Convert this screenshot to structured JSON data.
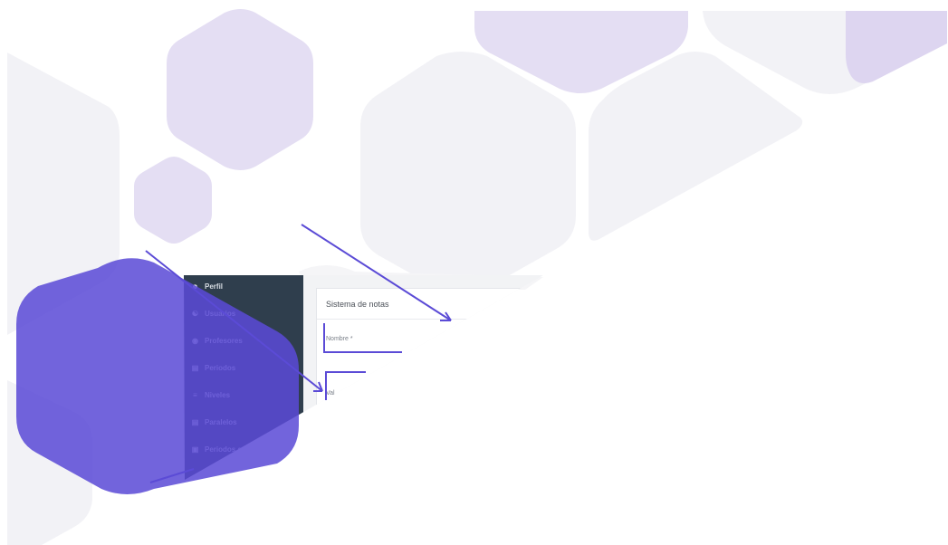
{
  "sidebar": {
    "items": [
      {
        "label": "Perfil",
        "icon": "user-icon"
      },
      {
        "label": "Usuarios",
        "icon": "users-icon"
      },
      {
        "label": "Profesores",
        "icon": "user-circle-icon"
      },
      {
        "label": "Periodos",
        "icon": "list-icon"
      },
      {
        "label": "Niveles",
        "icon": "list-ordered-icon"
      },
      {
        "label": "Paralelos",
        "icon": "list-icon"
      },
      {
        "label": "Periodos a",
        "icon": "calendar-icon"
      }
    ]
  },
  "main": {
    "card_title": "Sistema de notas",
    "fields": {
      "nombre_label": "Nombre *",
      "valor_label": "Val"
    }
  },
  "colors": {
    "accent": "#5b4bd6",
    "accent_light": "#e4def3",
    "hex_gray": "#f2f2f6",
    "sidebar_bg": "#2f3e4d"
  }
}
